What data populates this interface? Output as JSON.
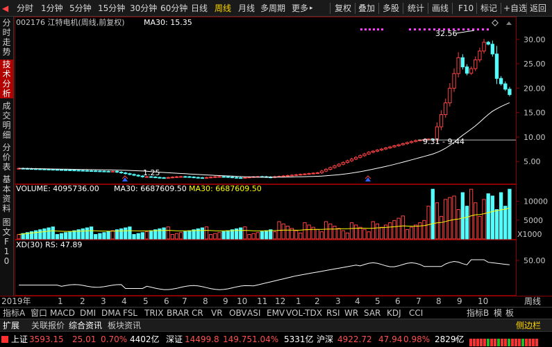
{
  "toolbar": {
    "back_icon": "left-arrow-icon",
    "periods": [
      "分时",
      "1分钟",
      "5分钟",
      "15分钟",
      "30分钟",
      "60分钟",
      "日线",
      "周线",
      "月线",
      "多周期",
      "更多"
    ],
    "active_period": "周线",
    "more_arrow": "▸",
    "right_buttons": [
      "复权",
      "叠加",
      "多股",
      "统计",
      "画线",
      "F10",
      "标记",
      "+自选",
      "返回"
    ]
  },
  "sidebar": [
    {
      "label": "分时走势",
      "active": false
    },
    {
      "label": "技术分析",
      "active": true
    },
    {
      "label": "成交明细",
      "active": false
    },
    {
      "label": "分价表",
      "active": false
    },
    {
      "label": "基本资料",
      "active": false
    },
    {
      "label": "图文F10",
      "active": false
    }
  ],
  "chart_data": [
    {
      "type": "candlestick",
      "title": "002176 江特电机(周线,前复权)",
      "ma_label": "MA30: 15.35",
      "ylim": [
        0.5,
        34.5
      ],
      "yticks": [
        5.0,
        10.0,
        15.0,
        20.0,
        25.0,
        30.0
      ],
      "annotations": [
        "32.56",
        "1.25",
        "9.31 - 9.44"
      ],
      "series_color_up": "#ff4444",
      "series_color_down": "#54fcfc",
      "ma_color": "#ffffff"
    },
    {
      "type": "bar",
      "label": "VOLUME: 4095736.00",
      "ma30_label": "MA30: 6687609.50",
      "ma30_label2": "MA30: 6687609.50",
      "yticks": [
        5000,
        10000
      ],
      "unit": "X1000"
    },
    {
      "type": "line",
      "label": "XD(30) RS: 47.89",
      "yticks": [
        50.0
      ]
    }
  ],
  "date_axis": {
    "labels": [
      "2019年",
      "1",
      "2",
      "3",
      "4",
      "5",
      "6",
      "7",
      "8",
      "9",
      "10",
      "11",
      "12",
      "1",
      "2",
      "3",
      "4",
      "5",
      "6",
      "7",
      "8",
      "9",
      "10"
    ],
    "period_label": "周线"
  },
  "tabs": {
    "items": [
      "指标A",
      "窗口",
      "MACD",
      "DMI",
      "DMA",
      "FSL",
      "TRIX",
      "BRAR",
      "CR",
      "VR",
      "OBV",
      "ASI",
      "EMV",
      "VOL-TDX",
      "RSI",
      "WR",
      "SAR",
      "KDJ",
      "CCI"
    ],
    "right_items": [
      "指标B",
      "模",
      "板"
    ]
  },
  "infobar": {
    "items": [
      "扩展",
      "关联报价",
      "综合资讯",
      "板块资讯"
    ],
    "right": "侧边栏"
  },
  "status": [
    {
      "name": "上证",
      "price": "3593.15",
      "chg": "25.01",
      "pct": "0.70%",
      "amt": "4402亿"
    },
    {
      "name": "深证",
      "price": "14499.8",
      "chg": "149.75",
      "pct": "1.04%",
      "amt": "5331亿"
    },
    {
      "name": "沪深",
      "price": "4922.72",
      "chg": "47.94",
      "pct": "0.98%",
      "amt": "2829亿"
    }
  ],
  "colors": {
    "up": "#ff4444",
    "down": "#54fcfc",
    "accent": "#ffd700",
    "axis": "#8b0000"
  }
}
